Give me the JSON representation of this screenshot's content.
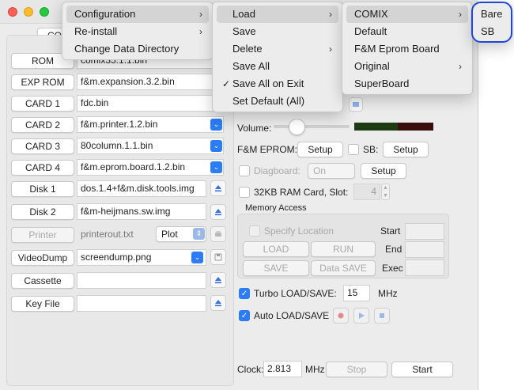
{
  "window": {
    "tab_label": "CO"
  },
  "left_panel": {
    "rows": [
      {
        "button": "ROM",
        "file": "comix35.1.1.bin"
      },
      {
        "button": "EXP ROM",
        "file": "f&m.expansion.3.2.bin"
      },
      {
        "button": "CARD 1",
        "file": "fdc.bin"
      },
      {
        "button": "CARD 2",
        "file": "f&m.printer.1.2.bin"
      },
      {
        "button": "CARD 3",
        "file": "80column.1.1.bin"
      },
      {
        "button": "CARD 4",
        "file": "f&m.eprom.board.1.2.bin"
      },
      {
        "button": "Disk 1",
        "file": "dos.1.4+f&m.disk.tools.img"
      },
      {
        "button": "Disk 2",
        "file": "f&m-heijmans.sw.img"
      }
    ],
    "printer": {
      "button": "Printer",
      "file": "printerout.txt",
      "mode": "Plot"
    },
    "videodump": {
      "button": "VideoDump",
      "file": "screendump.png"
    },
    "cassette": {
      "button": "Cassette",
      "file": ""
    },
    "keyfile": {
      "button": "Key File",
      "file": ""
    }
  },
  "right_panel": {
    "volume_label": "Volume:",
    "fm_eprom_label": "F&M EPROM:",
    "setup_label": "Setup",
    "sb_label": "SB:",
    "diagboard_label": "Diagboard:",
    "diagboard_value": "On",
    "ram_card_label": "32KB RAM Card, Slot:",
    "ram_card_slot": "4",
    "memory_access": {
      "title": "Memory Access",
      "specify_location": "Specify Location",
      "load": "LOAD",
      "run": "RUN",
      "save": "SAVE",
      "data_save": "Data SAVE",
      "start": "Start",
      "end": "End",
      "exec": "Exec"
    },
    "turbo_label": "Turbo LOAD/SAVE:",
    "turbo_value": "15",
    "turbo_unit": "MHz",
    "auto_label": "Auto LOAD/SAVE",
    "clock_label": "Clock:",
    "clock_value": "2.813",
    "clock_unit": "MHz",
    "stop_label": "Stop",
    "start_label": "Start"
  },
  "menus": {
    "main": [
      {
        "label": "Configuration",
        "submenu": true
      },
      {
        "label": "Re-install",
        "submenu": true
      },
      {
        "label": "Change Data Directory",
        "submenu": false
      }
    ],
    "configuration": [
      {
        "label": "Load",
        "submenu": true
      },
      {
        "label": "Save",
        "submenu": false
      },
      {
        "label": "Delete",
        "submenu": true
      },
      {
        "label": "Save All",
        "submenu": false
      },
      {
        "label": "Save All on Exit",
        "checked": true
      },
      {
        "label": "Set Default (All)",
        "submenu": false
      }
    ],
    "load": [
      {
        "label": "COMIX",
        "submenu": true
      },
      {
        "label": "Default",
        "submenu": false
      },
      {
        "label": "F&M Eprom Board",
        "submenu": false
      },
      {
        "label": "Original",
        "submenu": true
      },
      {
        "label": "SuperBoard",
        "submenu": false
      }
    ],
    "comix": [
      {
        "label": "Bare"
      },
      {
        "label": "SB"
      }
    ]
  },
  "colors": {
    "accent": "#2c7cf6",
    "highlight_ring": "#1e47d8"
  }
}
